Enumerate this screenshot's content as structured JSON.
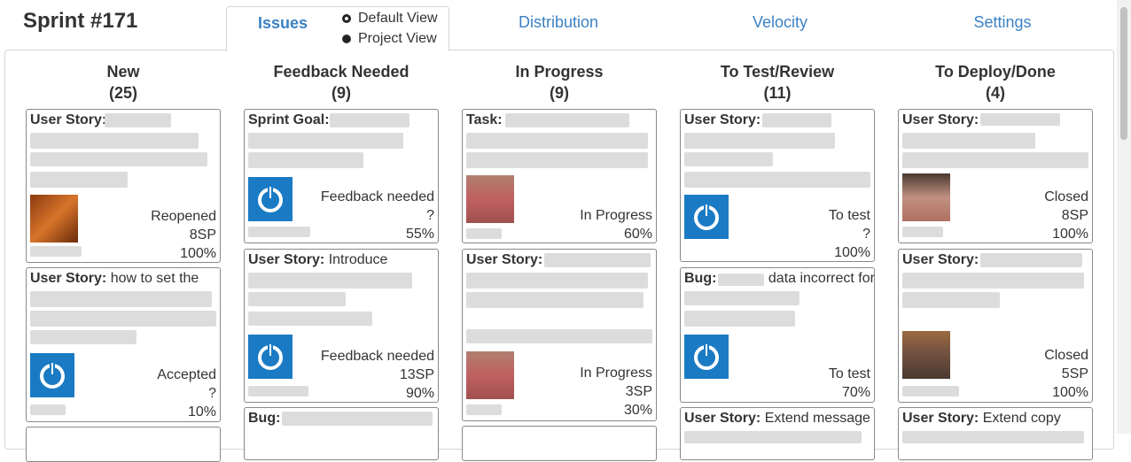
{
  "sprint_title": "Sprint #171",
  "tabs": {
    "issues": "Issues",
    "distribution": "Distribution",
    "velocity": "Velocity",
    "settings": "Settings"
  },
  "view_options": {
    "default": "Default View",
    "project": "Project View",
    "selected": "Default View"
  },
  "columns": [
    {
      "name": "New",
      "count": "(25)"
    },
    {
      "name": "Feedback Needed",
      "count": "(9)"
    },
    {
      "name": "In Progress",
      "count": "(9)"
    },
    {
      "name": "To Test/Review",
      "count": "(11)"
    },
    {
      "name": "To Deploy/Done",
      "count": "(4)"
    }
  ],
  "cards": {
    "c1": {
      "type": "User Story:",
      "text": "",
      "status": "Reopened",
      "points": "8SP",
      "progress": "100%"
    },
    "c2": {
      "type": "User Story:",
      "text": "how to set the",
      "status": "Accepted",
      "points": "?",
      "progress": "10%"
    },
    "c3": {
      "type": "User Story:",
      "text": "Introduce",
      "status": "Feedback needed",
      "points": "13SP",
      "progress": "90%"
    },
    "c4": {
      "type": "Sprint Goal:",
      "text": "",
      "status": "Feedback needed",
      "points": "?",
      "progress": "55%"
    },
    "c5": {
      "type": "Bug:",
      "text": ""
    },
    "c6": {
      "type": "Task:",
      "text": "",
      "status": "In Progress",
      "points": "",
      "progress": "60%"
    },
    "c7": {
      "type": "User Story:",
      "text": "",
      "status": "In Progress",
      "points": "3SP",
      "progress": "30%"
    },
    "c8": {
      "type": "User Story:",
      "text": "",
      "status": "To test",
      "points": "?",
      "progress": "100%"
    },
    "c9": {
      "type": "Bug:",
      "text": "data incorrect for",
      "status": "To test",
      "points": "",
      "progress": "70%"
    },
    "c10": {
      "type": "User Story:",
      "text": "Extend message"
    },
    "c11": {
      "type": "User Story:",
      "text": "",
      "status": "Closed",
      "points": "8SP",
      "progress": "100%"
    },
    "c12": {
      "type": "User Story:",
      "text": "",
      "status": "Closed",
      "points": "5SP",
      "progress": "100%"
    },
    "c13": {
      "type": "User Story:",
      "text": "Extend copy"
    }
  },
  "colors": {
    "accent": "#3b82c4",
    "app_icon": "#1a7bc4"
  }
}
